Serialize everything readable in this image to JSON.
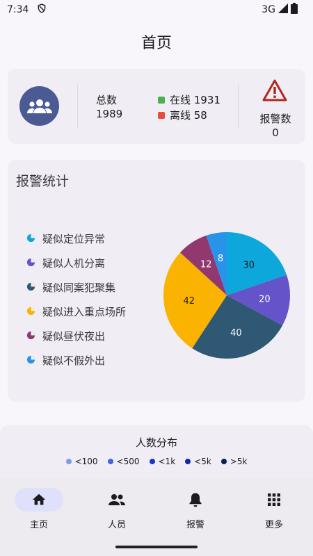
{
  "status_bar": {
    "time": "7:34",
    "network": "3G"
  },
  "header": {
    "title": "首页"
  },
  "summary": {
    "total_label": "总数",
    "total_value": "1989",
    "online_label": "在线 1931",
    "offline_label": "离线 58",
    "alarm_label": "报警数",
    "alarm_value": "0",
    "online_color": "#4caf50",
    "offline_color": "#e74c3c"
  },
  "alarm_stats": {
    "title": "报警统计",
    "legend": [
      {
        "label": "疑似定位异常",
        "color": "#0da7dc"
      },
      {
        "label": "疑似人机分离",
        "color": "#6554c9"
      },
      {
        "label": "疑似同案犯聚集",
        "color": "#2e5874"
      },
      {
        "label": "疑似进入重点场所",
        "color": "#fbb301"
      },
      {
        "label": "疑似昼伏夜出",
        "color": "#913870"
      },
      {
        "label": "疑似不假外出",
        "color": "#2993e9"
      }
    ]
  },
  "chart_data": {
    "type": "pie",
    "categories": [
      "疑似定位异常",
      "疑似人机分离",
      "疑似同案犯聚集",
      "疑似进入重点场所",
      "疑似昼伏夜出",
      "疑似不假外出"
    ],
    "values": [
      30,
      20,
      40,
      42,
      12,
      8
    ],
    "colors": [
      "#0da7dc",
      "#6554c9",
      "#2e5874",
      "#fbb301",
      "#913870",
      "#2993e9"
    ]
  },
  "distribution": {
    "title": "人数分布",
    "legend": [
      {
        "label": "<100",
        "color": "#7f9ce8"
      },
      {
        "label": "<500",
        "color": "#3f65dd"
      },
      {
        "label": "<1k",
        "color": "#1838c4"
      },
      {
        "label": "<5k",
        "color": "#0e2aa5"
      },
      {
        "label": ">5k",
        "color": "#0a1d63"
      }
    ]
  },
  "nav": {
    "items": [
      {
        "label": "主页",
        "icon": "home-icon"
      },
      {
        "label": "人员",
        "icon": "people-icon"
      },
      {
        "label": "报警",
        "icon": "bell-icon"
      },
      {
        "label": "更多",
        "icon": "apps-icon"
      }
    ]
  }
}
